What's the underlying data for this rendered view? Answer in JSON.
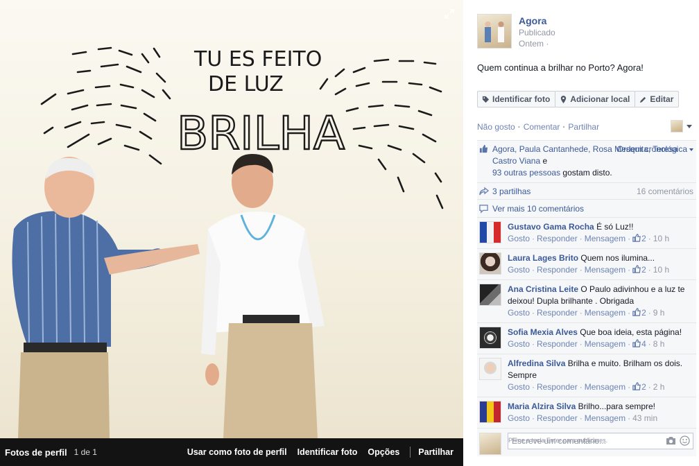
{
  "album": {
    "title": "Fotos de perfil",
    "count": "1 de 1",
    "actions": [
      "Usar como foto de perfil",
      "Identificar foto",
      "Opções",
      "Partilhar"
    ]
  },
  "photo": {
    "wall_text": [
      "TU ES FEITO",
      "DE LUZ",
      "BRILHA"
    ],
    "expand_icon": "expand-arrows-icon"
  },
  "post": {
    "author": "Agora",
    "meta_1": "Publicado",
    "meta_2": "Ontem ·",
    "caption": "Quem continua a brilhar no Porto? Agora!"
  },
  "buttons": {
    "tag": "Identificar foto",
    "location": "Adicionar local",
    "edit": "Editar"
  },
  "actions": {
    "unlike": "Não gosto",
    "comment": "Comentar",
    "share": "Partilhar"
  },
  "likes": {
    "names": "Agora, Paula Cantanhede, Rosa Mesquita, Teresa Castro Viana",
    "and": " e",
    "others": "93 outras pessoas",
    "suffix": " gostam disto.",
    "order": "Ordem cronológica"
  },
  "shares": {
    "label": "3 partilhas",
    "comments_count": "16 comentários"
  },
  "more_comments": "Ver mais 10 comentários",
  "comment_actions": {
    "like": "Gosto",
    "reply": "Responder",
    "message": "Mensagem"
  },
  "comments": [
    {
      "name": "Gustavo Gama Rocha",
      "text": "É só Luz!!",
      "likes": "2",
      "time": "10 h"
    },
    {
      "name": "Laura Lages Brito",
      "text": "Quem nos ilumina...",
      "likes": "2",
      "time": "10 h"
    },
    {
      "name": "Ana Cristina Leite",
      "text": "O Paulo adivinhou e a luz te deixou! Dupla brilhante . Obrigada",
      "likes": "2",
      "time": "9 h"
    },
    {
      "name": "Sofia Mexia Alves",
      "text": "Que boa ideia, esta página!",
      "likes": "4",
      "time": "8 h"
    },
    {
      "name": "Alfredina Silva",
      "text": "Brilha e muito. Brilham os dois. Sempre",
      "likes": "2",
      "time": "2 h"
    },
    {
      "name": "Maria Alzira Silva",
      "text": "Brilho...para sempre!",
      "likes": "",
      "time": "43 min"
    }
  ],
  "composer": {
    "placeholder": "Escreve um comentário...",
    "hint": "Prime a tecla Enter para publicares."
  },
  "colors": {
    "link": "#3b5998",
    "meta": "#9197a3",
    "ufi_bg": "#f6f7f9",
    "photo_bar": "#141414"
  }
}
